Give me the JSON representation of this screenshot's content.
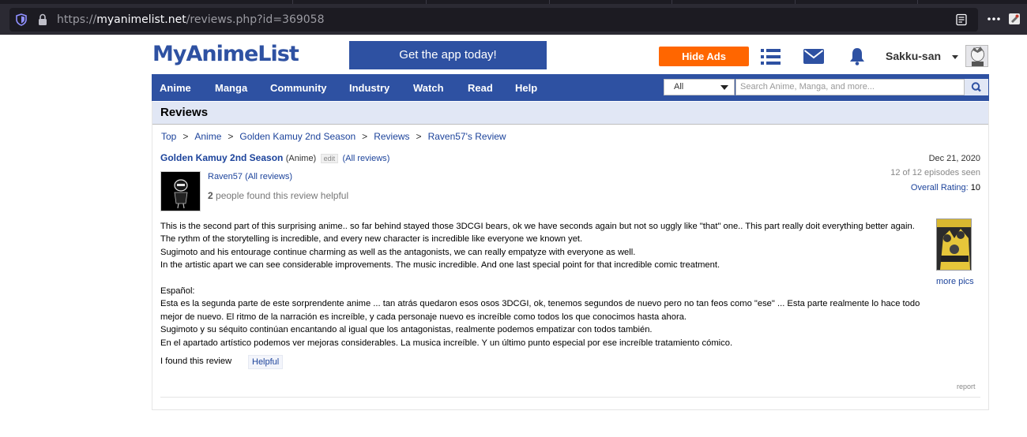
{
  "browser": {
    "url_prefix": "https://",
    "url_host": "myanimelist.net",
    "url_path": "/reviews.php?id=369058"
  },
  "header": {
    "logo": "MyAnimeList",
    "app_banner": "Get the app today!",
    "hide_ads": "Hide Ads",
    "username": "Sakku-san"
  },
  "nav": {
    "items": [
      "Anime",
      "Manga",
      "Community",
      "Industry",
      "Watch",
      "Read",
      "Help"
    ],
    "search_select": "All",
    "search_placeholder": "Search Anime, Manga, and more..."
  },
  "page": {
    "title": "Reviews",
    "breadcrumb": [
      "Top",
      "Anime",
      "Golden Kamuy 2nd Season",
      "Reviews",
      "Raven57's Review"
    ],
    "breadcrumb_sep": ">"
  },
  "review": {
    "anime_title": "Golden Kamuy 2nd Season",
    "anime_kind": "(Anime)",
    "edit": "edit",
    "all_reviews_open": "(",
    "all_reviews": "All reviews",
    "all_reviews_close": ")",
    "reviewer": "Raven57",
    "reviewer_all_reviews": "(All reviews)",
    "helpful_num": "2",
    "helpful_text": "people found this review helpful",
    "date": "Dec 21, 2020",
    "episodes": "12 of 12 episodes seen",
    "overall_label": "Overall Rating:",
    "overall_value": "10",
    "more_pics": "more pics",
    "body_en": [
      "This is the second part of this surprising anime.. so far behind stayed those 3DCGI bears, ok we have seconds again but not so uggly like \"that\" one.. This part really doit everything better again. The rythm of the storytelling is incredible, and every new character is incredible like everyone we known yet.",
      "Sugimoto and his entourage continue charming as well as the antagonists, we can really empatyze with everyone as well.",
      "In the artistic apart we can see considerable improvements. The music incredible. And one last special point for that incredible comic treatment."
    ],
    "body_es": [
      "Español:",
      "Esta es la segunda parte de este sorprendente anime ... tan atrás quedaron esos osos 3DCGI, ok, tenemos segundos de nuevo pero no tan feos como \"ese\" ... Esta parte realmente lo hace todo mejor de nuevo. El ritmo de la narración es increíble, y cada personaje nuevo es increíble como todos los que conocimos hasta ahora.",
      "Sugimoto y su séquito continúan encantando al igual que los antagonistas, realmente podemos empatizar con todos también.",
      "En el apartado artístico podemos ver mejoras considerables. La musica increíble. Y un último punto especial por ese increíble tratamiento cómico."
    ],
    "found_text": "I found this review",
    "helpful_button": "Helpful",
    "report": "report"
  },
  "colors": {
    "brand_blue": "#2e51a2",
    "link": "#1c439b",
    "accent_orange": "#ff6600",
    "header_bg": "#e1e7f5"
  }
}
